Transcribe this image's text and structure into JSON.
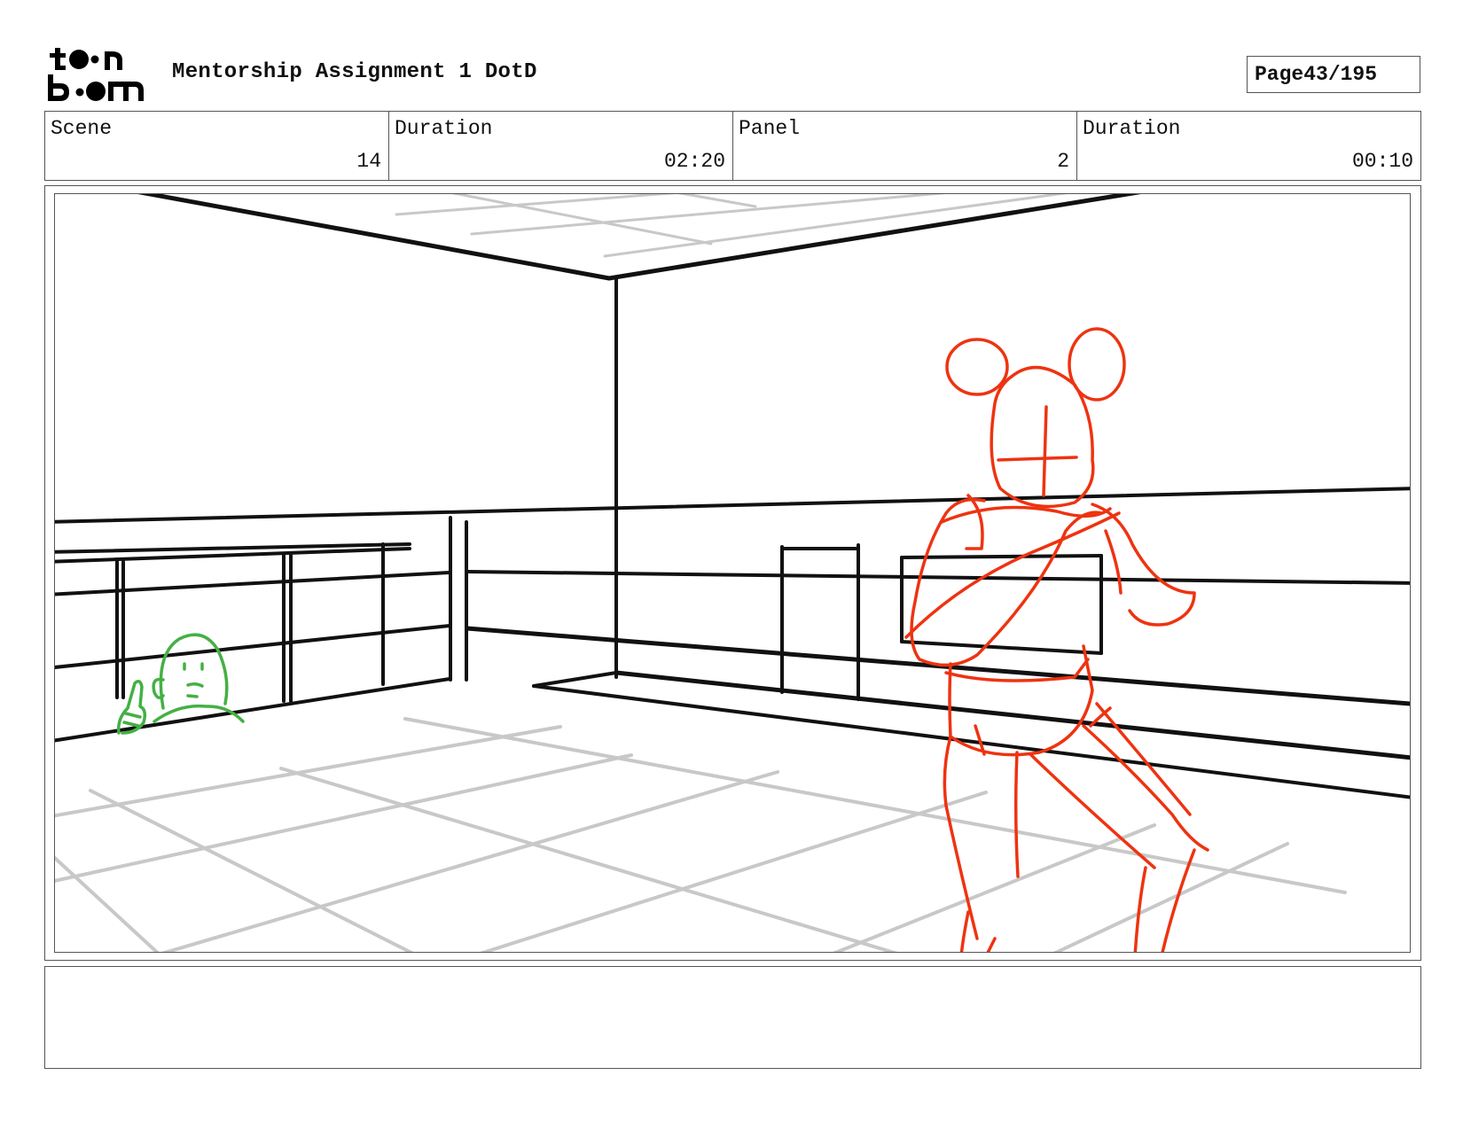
{
  "header": {
    "logo_text_top": "toon",
    "logo_text_bottom": "boom",
    "title": "Mentorship Assignment 1 DotD",
    "page_label": "Page",
    "page_value": "43/195"
  },
  "info": [
    {
      "label": "Scene",
      "value": "14"
    },
    {
      "label": "Duration",
      "value": "02:20"
    },
    {
      "label": "Panel",
      "value": "2"
    },
    {
      "label": "Duration",
      "value": "00:10"
    }
  ],
  "panel": {
    "description": "",
    "colors": {
      "room_lines": "#111111",
      "floor_grid": "#c8c8c8",
      "main_character": "#ee3311",
      "background_character": "#44b044"
    }
  },
  "notes": ""
}
